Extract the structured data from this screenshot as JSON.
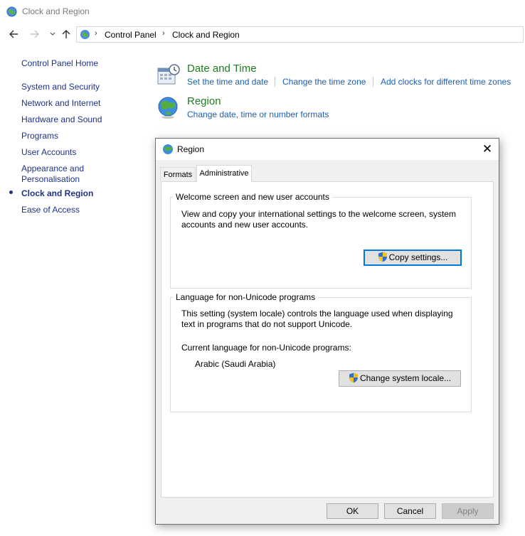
{
  "window": {
    "title": "Clock and Region"
  },
  "nav": {
    "back_icon": "arrow-left-icon",
    "forward_icon": "arrow-right-icon",
    "recent_icon": "chevron-down-icon",
    "up_icon": "arrow-up-icon",
    "sep": "›",
    "breadcrumbs": [
      "Control Panel",
      "Clock and Region"
    ]
  },
  "left_pane": {
    "home": "Control Panel Home",
    "items": [
      "System and Security",
      "Network and Internet",
      "Hardware and Sound",
      "Programs",
      "User Accounts",
      "Appearance and",
      "Personalisation",
      "Clock and Region",
      "Ease of Access"
    ]
  },
  "content": {
    "date_time": {
      "title": "Date and Time",
      "links": [
        "Set the time and date",
        "Change the time zone",
        "Add clocks for different time zones"
      ]
    },
    "region": {
      "title": "Region",
      "links": [
        "Change date, time or number formats"
      ]
    }
  },
  "dialog": {
    "title": "Region",
    "close": "✕",
    "tabs": [
      "Formats",
      "Administrative"
    ],
    "welcome": {
      "legend": "Welcome screen and new user accounts",
      "line1": "View and copy your international settings to the welcome screen, system",
      "line2": "accounts and new user accounts.",
      "button": "Copy settings..."
    },
    "unicode": {
      "legend": "Language for non-Unicode programs",
      "line1": "This setting (system locale) controls the language used when displaying",
      "line2": "text in programs that do not support Unicode.",
      "current_label": "Current language for non-Unicode programs:",
      "current_value": "Arabic (Saudi Arabia)",
      "button": "Change system locale..."
    },
    "buttons": {
      "ok": "OK",
      "cancel": "Cancel",
      "apply": "Apply"
    }
  },
  "colors": {
    "link": "#1a5fb4",
    "category_title": "#1e7d1e",
    "nav_text": "#1e3287",
    "focus": "#0078d7"
  }
}
